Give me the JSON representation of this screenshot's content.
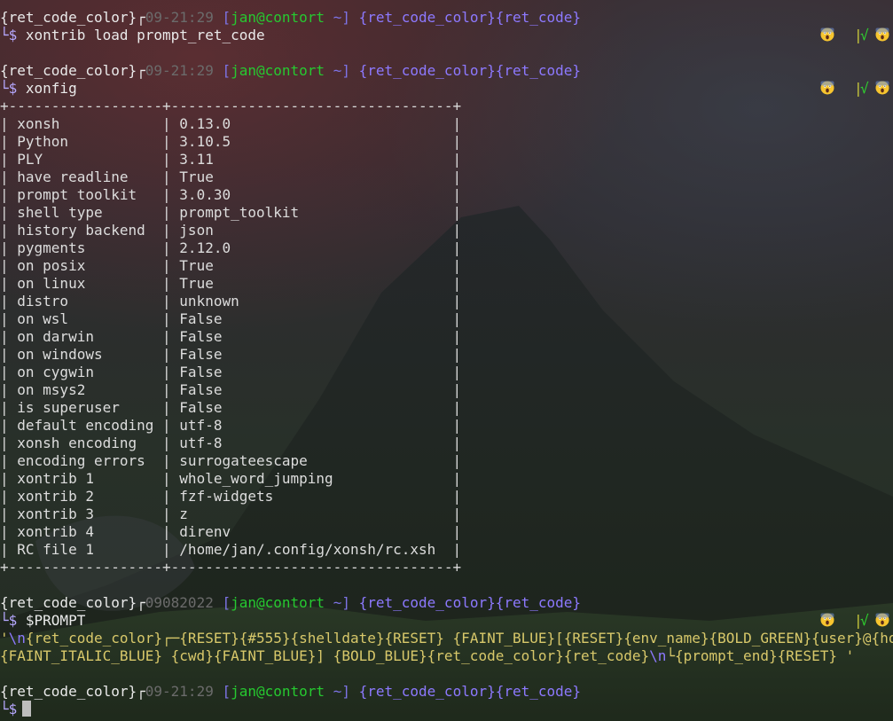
{
  "colors": {
    "prompt_text": "#eaeaea",
    "date": "#6b6b6b",
    "blue": "#7d73e6",
    "green": "#26c930",
    "purple": "#8d79ff",
    "yellow": "#d8c86a",
    "bar": "#c9c93c",
    "check": "#2fd12f"
  },
  "icons": {
    "emoji": "face-screaming-in-fear-icon",
    "check": "check-icon",
    "bar": "prompt-separator-bar"
  },
  "prompt1": {
    "prefix": "{ret_code_color}┌",
    "date": "09-21:29",
    "open_bracket": " [",
    "user_host": "jan@contort",
    "path": " ~",
    "close_bracket": "]",
    "suffix": " {ret_code_color}{ret_code}",
    "dollar": "└$",
    "command": " xontrib load prompt_ret_code",
    "right_check": "√"
  },
  "prompt2": {
    "prefix": "{ret_code_color}┌",
    "date": "09-21:29",
    "open_bracket": " [",
    "user_host": "jan@contort",
    "path": " ~",
    "close_bracket": "]",
    "suffix": " {ret_code_color}{ret_code}",
    "dollar": "└$",
    "command": " xonfig",
    "right_check": "√"
  },
  "xonfig_table": {
    "border": "+------------------+---------------------------------+",
    "rows": [
      [
        "xonsh",
        "0.13.0"
      ],
      [
        "Python",
        "3.10.5"
      ],
      [
        "PLY",
        "3.11"
      ],
      [
        "have readline",
        "True"
      ],
      [
        "prompt toolkit",
        "3.0.30"
      ],
      [
        "shell type",
        "prompt_toolkit"
      ],
      [
        "history backend",
        "json"
      ],
      [
        "pygments",
        "2.12.0"
      ],
      [
        "on posix",
        "True"
      ],
      [
        "on linux",
        "True"
      ],
      [
        "distro",
        "unknown"
      ],
      [
        "on wsl",
        "False"
      ],
      [
        "on darwin",
        "False"
      ],
      [
        "on windows",
        "False"
      ],
      [
        "on cygwin",
        "False"
      ],
      [
        "on msys2",
        "False"
      ],
      [
        "is superuser",
        "False"
      ],
      [
        "default encoding",
        "utf-8"
      ],
      [
        "xonsh encoding",
        "utf-8"
      ],
      [
        "encoding errors",
        "surrogateescape"
      ],
      [
        "xontrib 1",
        "whole_word_jumping"
      ],
      [
        "xontrib 2",
        "fzf-widgets"
      ],
      [
        "xontrib 3",
        "z"
      ],
      [
        "xontrib 4",
        "direnv"
      ],
      [
        "RC file 1",
        "/home/jan/.config/xonsh/rc.xsh"
      ]
    ]
  },
  "prompt3": {
    "prefix": "{ret_code_color}┌",
    "date": "09082022",
    "open_bracket": " [",
    "user_host": "jan@contort",
    "path": " ~",
    "close_bracket": "]",
    "suffix": " {ret_code_color}{ret_code}",
    "dollar": "└$",
    "command": " $PROMPT",
    "right_check": "√"
  },
  "output_prompt": {
    "line1_q": "'",
    "line1_nl": "\\n",
    "line1_rest": "{ret_code_color}┌─{RESET}{#555}{shelldate}{RESET} {FAINT_BLUE}[{RESET}{env_name}{BOLD_GREEN}{user}@{hostname}",
    "line2_a": "{FAINT_ITALIC_BLUE} {cwd}{FAINT_BLUE}] {BOLD_BLUE}{ret_code_color}{ret_code}",
    "line2_nl": "\\n",
    "line2_b": "└{prompt_end}{RESET} '"
  },
  "prompt4": {
    "prefix": "{ret_code_color}┌",
    "date": "09-21:29",
    "open_bracket": " [",
    "user_host": "jan@contort",
    "path": " ~",
    "close_bracket": "]",
    "suffix": " {ret_code_color}{ret_code}",
    "dollar": "└$"
  }
}
